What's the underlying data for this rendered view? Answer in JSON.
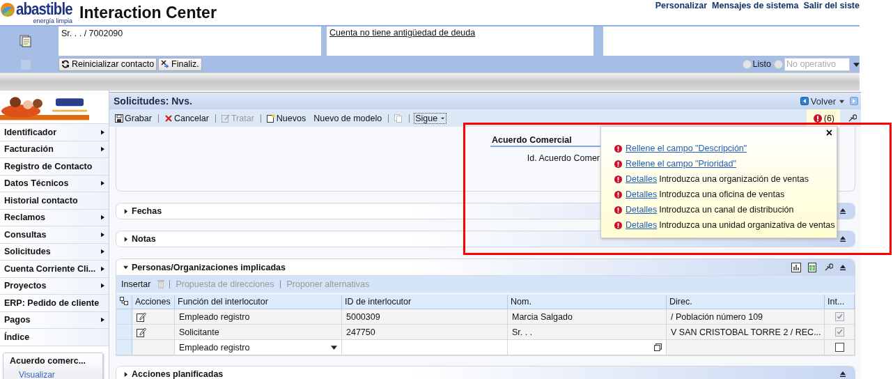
{
  "header": {
    "logo": {
      "name": "abastible",
      "tagline": "energía limpia"
    },
    "title": "Interaction Center",
    "links": [
      "Personalizar",
      "Mensajes de sistema",
      "Salir del siste"
    ]
  },
  "contact_bar": {
    "fields": [
      {
        "text": "Sr. . . / 7002090",
        "underlined": false
      },
      {
        "text": "Cuenta no tiene antigüedad de deuda",
        "underlined": true
      }
    ],
    "buttons": [
      {
        "label": "Reinicializar contacto",
        "kind": "refresh"
      },
      {
        "label": "Finaliz.",
        "kind": "end"
      }
    ],
    "status": {
      "label": "Listo",
      "selected": false,
      "offline_selected": false,
      "select_value": "No operativo",
      "select_disabled": true
    }
  },
  "sidebar": {
    "items": [
      {
        "label": "Identificador",
        "has_submenu": true
      },
      {
        "label": "Facturación",
        "has_submenu": true
      },
      {
        "label": "Registro de Contacto",
        "has_submenu": false
      },
      {
        "label": "Datos Técnicos",
        "has_submenu": true
      },
      {
        "label": "Historial contacto",
        "has_submenu": false
      },
      {
        "label": "Reclamos",
        "has_submenu": true
      },
      {
        "label": "Consultas",
        "has_submenu": true
      },
      {
        "label": "Solicitudes",
        "has_submenu": true
      },
      {
        "label": "Cuenta Corriente Cli...",
        "has_submenu": true
      },
      {
        "label": "Proyectos",
        "has_submenu": true
      },
      {
        "label": "ERP: Pedido de cliente",
        "has_submenu": false
      },
      {
        "label": "Pagos",
        "has_submenu": true
      },
      {
        "label": "Índice",
        "has_submenu": false
      }
    ],
    "card": {
      "title": "Acuerdo comerc...",
      "link": "Visualizar"
    }
  },
  "page": {
    "title": "Solicitudes: Nvs.",
    "back": "Volver",
    "toolbar": [
      {
        "label": "Grabar",
        "kind": "save",
        "disabled": false
      },
      {
        "label": "Cancelar",
        "kind": "cancel",
        "disabled": false
      },
      {
        "label": "Tratar",
        "kind": "edit",
        "disabled": true
      },
      {
        "label": "Nuevos",
        "kind": "new",
        "disabled": false
      },
      {
        "label": "Nuevo de modelo",
        "kind": "plain",
        "disabled": false
      },
      {
        "kind": "copy",
        "disabled": true
      },
      {
        "label": "Sigue",
        "kind": "more",
        "disabled": false
      }
    ],
    "message_count": "(6)",
    "form": {
      "heading": "Acuerdo Comercial",
      "field_label": "Id. Acuerdo Comer"
    },
    "panels": [
      {
        "title": "Fechas",
        "expanded": false
      },
      {
        "title": "Notas",
        "expanded": false
      },
      {
        "title": "Personas/Organizaciones implicadas",
        "expanded": true
      },
      {
        "title": "Acciones planificadas",
        "expanded": false
      }
    ],
    "table": {
      "toolbar": [
        {
          "label": "Insertar",
          "kind": "text",
          "disabled": false
        },
        {
          "kind": "delete",
          "disabled": true
        },
        {
          "label": "Propuesta de direcciones",
          "kind": "text",
          "disabled": true
        },
        {
          "label": "Proponer alternativas",
          "kind": "text",
          "disabled": true
        }
      ],
      "columns": [
        "Acciones",
        "Función del interlocutor",
        "ID de interlocutor",
        "Nom.",
        "Direc.",
        "Int..."
      ],
      "rows": [
        {
          "editable": false,
          "function": "Empleado registro",
          "id": "5000309",
          "name": "Marcia Salgado",
          "address": "/ Población número 109",
          "checked": true
        },
        {
          "editable": false,
          "function": "Solicitante",
          "id": "247750",
          "name": "Sr. . .",
          "address": "V SAN CRISTOBAL TORRE 2 / REC...",
          "checked": true
        },
        {
          "editable": true,
          "function": "Empleado registro",
          "checked": false
        }
      ]
    }
  },
  "messages_popup": {
    "close": "×",
    "messages": [
      {
        "link": "Rellene el campo \"Descripción\""
      },
      {
        "link": "Rellene el campo \"Prioridad\""
      },
      {
        "link": "Detalles",
        "text": "Introduzca una organización de ventas"
      },
      {
        "link": "Detalles",
        "text": "Introduzca una oficina de ventas"
      },
      {
        "link": "Detalles",
        "text": "Introduzca un canal de distribución"
      },
      {
        "link": "Detalles",
        "text": "Introduzca una unidad organizativa de ventas"
      }
    ]
  },
  "annotation": {
    "highlight_frame": true
  }
}
